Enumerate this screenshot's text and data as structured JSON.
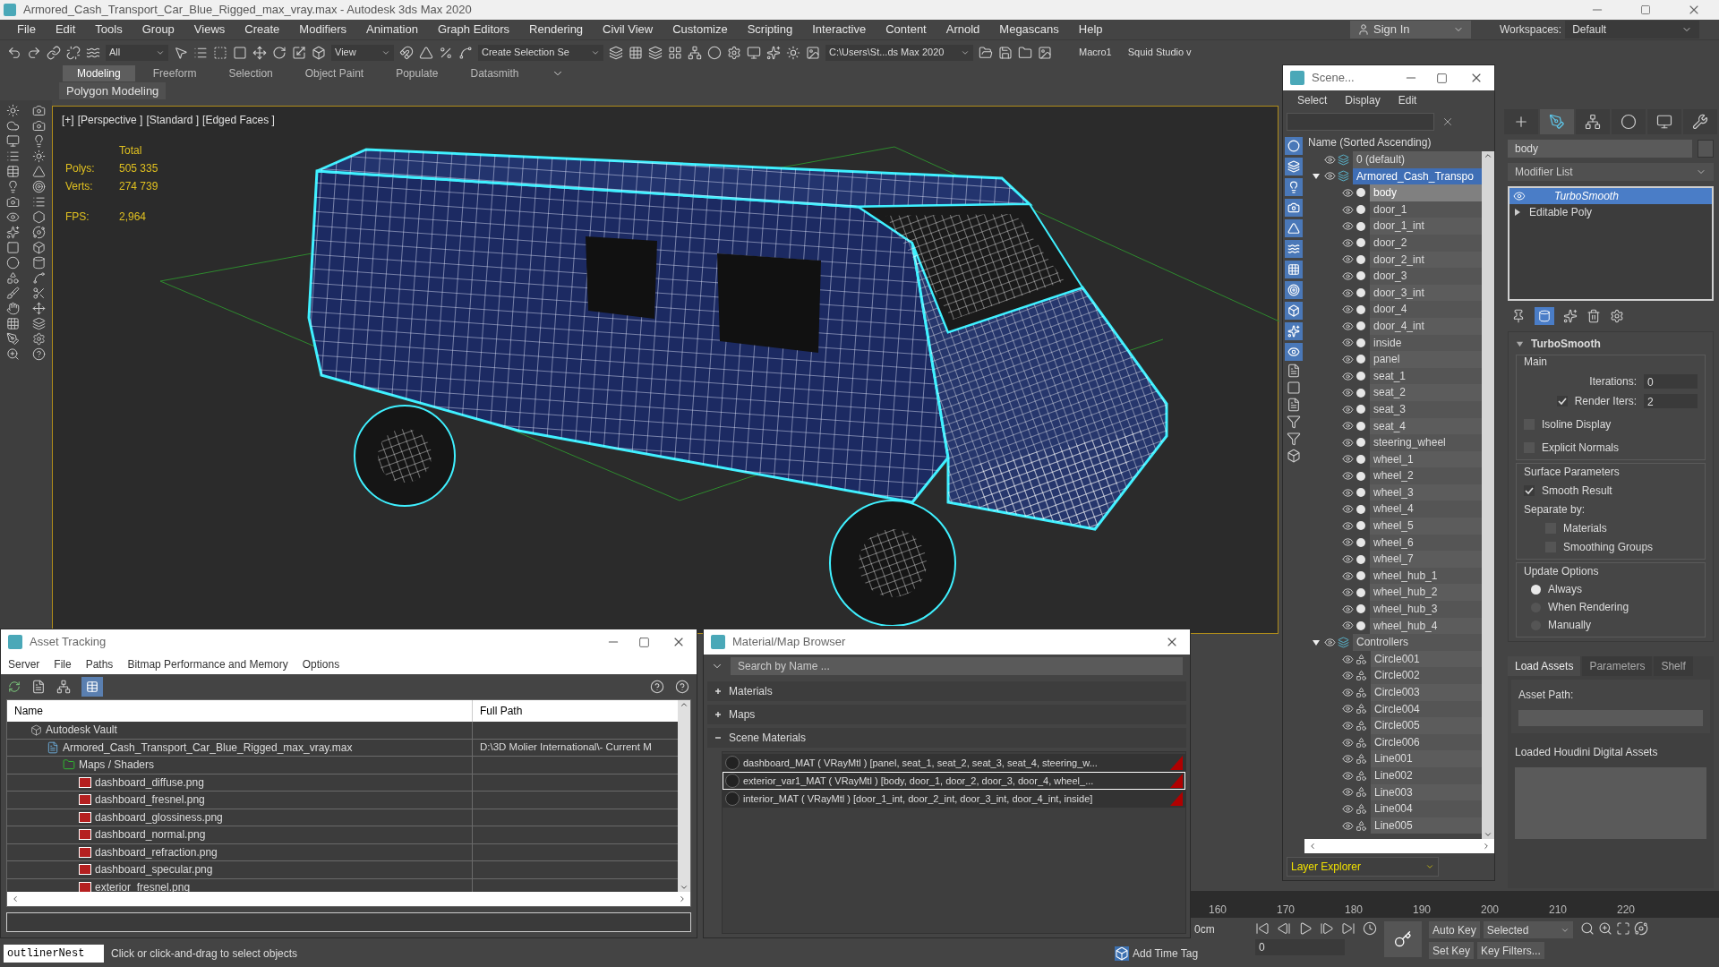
{
  "window": {
    "title": "Armored_Cash_Transport_Car_Blue_Rigged_max_vray.max - Autodesk 3ds Max 2020"
  },
  "menu": [
    "File",
    "Edit",
    "Tools",
    "Group",
    "Views",
    "Create",
    "Modifiers",
    "Animation",
    "Graph Editors",
    "Rendering",
    "Civil View",
    "Customize",
    "Scripting",
    "Interactive",
    "Content",
    "Arnold",
    "Megascans",
    "Help"
  ],
  "account": {
    "sign_in": "Sign In",
    "workspaces_label": "Workspaces:",
    "workspace": "Default"
  },
  "toolbar": {
    "selection_filter": "All",
    "reference_coord": "View",
    "named_selection": "Create Selection Se",
    "project_path": "C:\\Users\\St...ds Max 2020",
    "macro": "Macro1",
    "plugin": "Squid Studio v"
  },
  "ribbon": {
    "tabs": [
      {
        "label": "Modeling",
        "selected": true
      },
      {
        "label": "Freeform",
        "selected": false
      },
      {
        "label": "Selection",
        "selected": false
      },
      {
        "label": "Object Paint",
        "selected": false
      },
      {
        "label": "Populate",
        "selected": false
      },
      {
        "label": "Datasmith",
        "selected": false
      }
    ],
    "panel": "Polygon Modeling"
  },
  "viewport": {
    "labels": [
      "[+]",
      "[Perspective ]",
      "[Standard ]",
      "[Edged Faces ]"
    ],
    "stats_header": "Total",
    "stats": [
      {
        "label": "Polys:",
        "value": "505 335"
      },
      {
        "label": "Verts:",
        "value": "274 739"
      }
    ],
    "fps": {
      "label": "FPS:",
      "value": "2,964"
    }
  },
  "scene_explorer": {
    "title": "Scene...",
    "menu": [
      "Select",
      "Display",
      "Edit"
    ],
    "column": "Name (Sorted Ascending)",
    "footer": "Layer Explorer",
    "tree": [
      {
        "name": "0 (default)",
        "kind": "layer",
        "selected": false
      },
      {
        "name": "Armored_Cash_Transpo",
        "kind": "layer",
        "selected": true,
        "expanded": true,
        "children": [
          {
            "name": "body",
            "kind": "geometry",
            "selected": true
          },
          {
            "name": "door_1",
            "kind": "geometry",
            "selected": false
          },
          {
            "name": "door_1_int",
            "kind": "geometry",
            "selected": false
          },
          {
            "name": "door_2",
            "kind": "geometry",
            "selected": false
          },
          {
            "name": "door_2_int",
            "kind": "geometry",
            "selected": false
          },
          {
            "name": "door_3",
            "kind": "geometry",
            "selected": false
          },
          {
            "name": "door_3_int",
            "kind": "geometry",
            "selected": false
          },
          {
            "name": "door_4",
            "kind": "geometry",
            "selected": false
          },
          {
            "name": "door_4_int",
            "kind": "geometry",
            "selected": false
          },
          {
            "name": "inside",
            "kind": "geometry",
            "selected": false
          },
          {
            "name": "panel",
            "kind": "geometry",
            "selected": false
          },
          {
            "name": "seat_1",
            "kind": "geometry",
            "selected": false
          },
          {
            "name": "seat_2",
            "kind": "geometry",
            "selected": false
          },
          {
            "name": "seat_3",
            "kind": "geometry",
            "selected": false
          },
          {
            "name": "seat_4",
            "kind": "geometry",
            "selected": false
          },
          {
            "name": "steering_wheel",
            "kind": "geometry",
            "selected": false
          },
          {
            "name": "wheel_1",
            "kind": "geometry",
            "selected": false
          },
          {
            "name": "wheel_2",
            "kind": "geometry",
            "selected": false
          },
          {
            "name": "wheel_3",
            "kind": "geometry",
            "selected": false
          },
          {
            "name": "wheel_4",
            "kind": "geometry",
            "selected": false
          },
          {
            "name": "wheel_5",
            "kind": "geometry",
            "selected": false
          },
          {
            "name": "wheel_6",
            "kind": "geometry",
            "selected": false
          },
          {
            "name": "wheel_7",
            "kind": "geometry",
            "selected": false
          },
          {
            "name": "wheel_hub_1",
            "kind": "geometry",
            "selected": false
          },
          {
            "name": "wheel_hub_2",
            "kind": "geometry",
            "selected": false
          },
          {
            "name": "wheel_hub_3",
            "kind": "geometry",
            "selected": false
          },
          {
            "name": "wheel_hub_4",
            "kind": "geometry",
            "selected": false
          }
        ]
      },
      {
        "name": "Controllers",
        "kind": "layer",
        "selected": false,
        "expanded": true,
        "children": [
          {
            "name": "Circle001",
            "kind": "shape",
            "selected": false
          },
          {
            "name": "Circle002",
            "kind": "shape",
            "selected": false
          },
          {
            "name": "Circle003",
            "kind": "shape",
            "selected": false
          },
          {
            "name": "Circle004",
            "kind": "shape",
            "selected": false
          },
          {
            "name": "Circle005",
            "kind": "shape",
            "selected": false
          },
          {
            "name": "Circle006",
            "kind": "shape",
            "selected": false
          },
          {
            "name": "Line001",
            "kind": "shape",
            "selected": false
          },
          {
            "name": "Line002",
            "kind": "shape",
            "selected": false
          },
          {
            "name": "Line003",
            "kind": "shape",
            "selected": false
          },
          {
            "name": "Line004",
            "kind": "shape",
            "selected": false
          },
          {
            "name": "Line005",
            "kind": "shape",
            "selected": false
          }
        ]
      }
    ]
  },
  "command_panel": {
    "tabs": [
      {
        "kind": "create",
        "selected": false
      },
      {
        "kind": "modify",
        "selected": true
      },
      {
        "kind": "hierarchy",
        "selected": false
      },
      {
        "kind": "motion",
        "selected": false
      },
      {
        "kind": "display",
        "selected": false
      },
      {
        "kind": "utilities",
        "selected": false
      }
    ],
    "object_name": "body",
    "modifier_list": "Modifier List",
    "stack": [
      {
        "name": "TurboSmooth",
        "kind": "modifier",
        "selected": true
      },
      {
        "name": "Editable Poly",
        "kind": "base",
        "selected": false
      }
    ],
    "show_end_result": true,
    "rollout": {
      "title": "TurboSmooth",
      "expanded": true,
      "main": {
        "title": "Main",
        "iterations": {
          "label": "Iterations:",
          "value": "0"
        },
        "render_iters": {
          "label": "Render Iters:",
          "checked": true,
          "value": "2"
        },
        "checks": [
          {
            "label": "Isoline Display",
            "checked": false
          },
          {
            "label": "Explicit Normals",
            "checked": false
          }
        ]
      },
      "surface": {
        "title": "Surface Parameters",
        "smooth_result": {
          "label": "Smooth Result",
          "checked": true
        },
        "separate_label": "Separate by:",
        "separate": [
          {
            "label": "Materials",
            "checked": false
          },
          {
            "label": "Smoothing Groups",
            "checked": false
          }
        ]
      },
      "update": {
        "title": "Update Options",
        "options": [
          {
            "label": "Always",
            "selected": true
          },
          {
            "label": "When Rendering",
            "selected": false
          },
          {
            "label": "Manually",
            "selected": false
          }
        ]
      }
    },
    "houdini": {
      "tabs": [
        {
          "label": "Load Assets",
          "selected": true
        },
        {
          "label": "Parameters",
          "selected": false
        },
        {
          "label": "Shelf",
          "selected": false
        }
      ],
      "asset_path_label": "Asset Path:",
      "loaded_label": "Loaded Houdini Digital Assets"
    }
  },
  "asset_tracking": {
    "title": "Asset Tracking",
    "menu": [
      "Server",
      "File",
      "Paths",
      "Bitmap Performance and Memory",
      "Options"
    ],
    "columns": [
      "Name",
      "Full Path"
    ],
    "rows": [
      {
        "name": "Autodesk Vault",
        "kind": "vault",
        "children": [
          {
            "name": "Armored_Cash_Transport_Car_Blue_Rigged_max_vray.max",
            "kind": "scene",
            "path": "D:\\3D Molier International\\- Current M",
            "children": [
              {
                "name": "Maps / Shaders",
                "kind": "folder",
                "children": [
                  {
                    "name": "dashboard_diffuse.png",
                    "kind": "image"
                  },
                  {
                    "name": "dashboard_fresnel.png",
                    "kind": "image"
                  },
                  {
                    "name": "dashboard_glossiness.png",
                    "kind": "image"
                  },
                  {
                    "name": "dashboard_normal.png",
                    "kind": "image"
                  },
                  {
                    "name": "dashboard_refraction.png",
                    "kind": "image"
                  },
                  {
                    "name": "dashboard_specular.png",
                    "kind": "image"
                  },
                  {
                    "name": "exterior_fresnel.png",
                    "kind": "image"
                  }
                ]
              }
            ]
          }
        ]
      }
    ]
  },
  "material_browser": {
    "title": "Material/Map Browser",
    "search": {
      "placeholder": "Search by Name ..."
    },
    "groups": [
      {
        "label": "Materials",
        "expanded": false
      },
      {
        "label": "Maps",
        "expanded": false
      },
      {
        "label": "Scene Materials",
        "expanded": true,
        "items": [
          {
            "label": "dashboard_MAT ( VRayMtl ) [panel, seat_1, seat_2, seat_3, seat_4, steering_w...",
            "selected": false
          },
          {
            "label": "exterior_var1_MAT ( VRayMtl ) [body, door_1, door_2, door_3, door_4, wheel_...",
            "selected": true
          },
          {
            "label": "interior_MAT ( VRayMtl ) [door_1_int, door_2_int, door_3_int, door_4_int, inside]",
            "selected": false
          }
        ]
      }
    ]
  },
  "timeline": {
    "unit": "0cm",
    "ticks": [
      "160",
      "170",
      "180",
      "190",
      "200",
      "210",
      "220"
    ]
  },
  "animation": {
    "frame": "0",
    "auto_key": "Auto Key",
    "key_mode": "Selected",
    "set_key": "Set Key",
    "key_filters": "Key Filters..."
  },
  "status": {
    "listener": "outlinerNest",
    "prompt": "Click or click-and-drag to select objects",
    "time_tag": "Add Time Tag"
  }
}
